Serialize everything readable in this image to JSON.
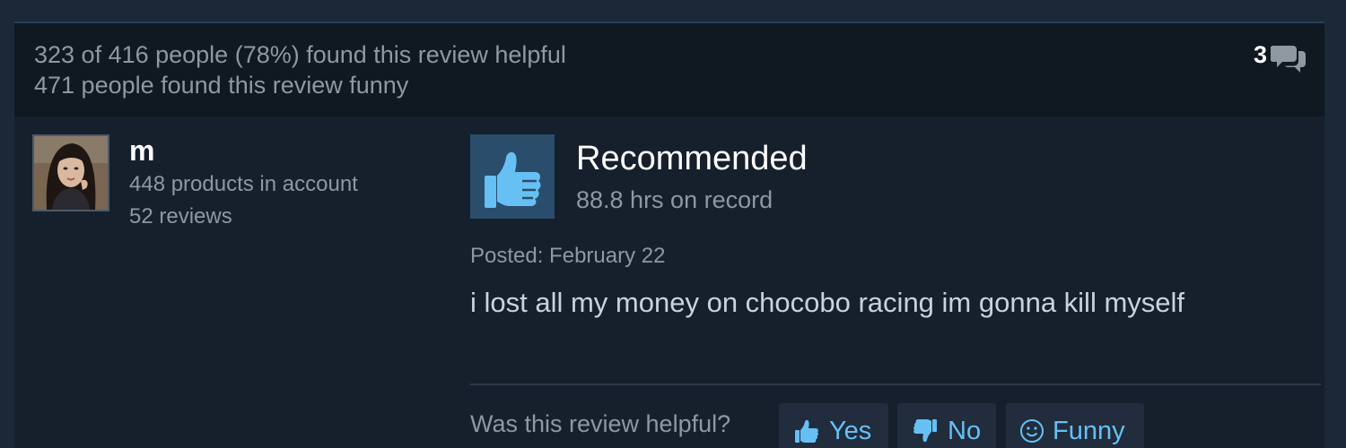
{
  "header": {
    "helpful_text": "323 of 416 people (78%) found this review helpful",
    "funny_text": "471 people found this review funny",
    "comment_count": "3",
    "comment_icon": "comments-icon"
  },
  "author": {
    "name": "m",
    "products": "448 products in account",
    "reviews": "52 reviews",
    "avatar_icon": "avatar"
  },
  "review": {
    "verdict": "Recommended",
    "verdict_icon": "thumbs-up-icon",
    "hours": "88.8 hrs on record",
    "posted": "Posted: February 22",
    "text": "i lost all my money on chocobo racing im gonna kill myself"
  },
  "footer": {
    "prompt": "Was this review helpful?",
    "yes_label": "Yes",
    "no_label": "No",
    "funny_label": "Funny"
  },
  "colors": {
    "background": "#1b2838",
    "card": "#16202d",
    "header": "#101822",
    "accent": "#66c0f4",
    "muted_text": "#8f98a0",
    "thumb_box": "#2a4d6b"
  }
}
